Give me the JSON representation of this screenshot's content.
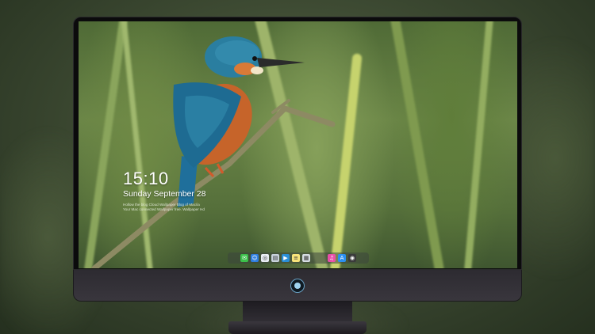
{
  "lockscreen": {
    "time": "15:10",
    "date": "Sunday September 28",
    "notice_line1": "Hollow the blog Cloud Wallpaper Blog of Mac/ia",
    "notice_line2": "Your Mac connected Wallpaper free. Wallpaper Hd"
  },
  "dock": {
    "icons": [
      {
        "name": "messages-icon",
        "glyph": "✉",
        "color": "#3cc04a"
      },
      {
        "name": "finder-icon",
        "glyph": "☺",
        "color": "#2f7fe0"
      },
      {
        "name": "safari-icon",
        "glyph": "◎",
        "color": "#e9eef3"
      },
      {
        "name": "preview-icon",
        "glyph": "▤",
        "color": "#c9d3dc"
      },
      {
        "name": "claquette-icon",
        "glyph": "▶",
        "color": "#2a8fd8"
      },
      {
        "name": "notes-icon",
        "glyph": "≡",
        "color": "#f7e37a"
      },
      {
        "name": "photos-icon",
        "glyph": "▦",
        "color": "#d6dde3"
      },
      {
        "name": "itunes-icon",
        "glyph": "♫",
        "color": "#e84fa8"
      },
      {
        "name": "app-store-icon",
        "glyph": "A",
        "color": "#2b8ff0"
      },
      {
        "name": "camera-icon",
        "glyph": "◉",
        "color": "#3b3b3b"
      }
    ]
  }
}
